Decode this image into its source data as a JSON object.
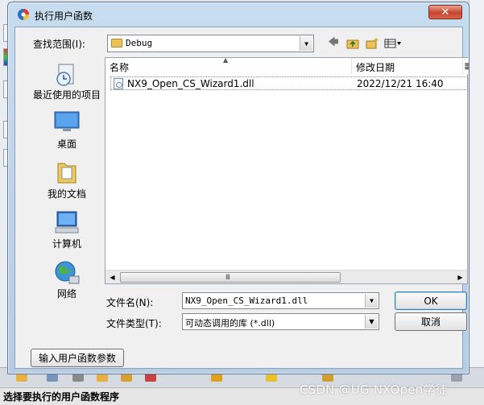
{
  "dialog": {
    "title": "执行用户函数",
    "close_glyph": "✕"
  },
  "look_in": {
    "label": "查找范围(I):",
    "value": "Debug"
  },
  "places": [
    {
      "label": "最近使用的项目",
      "icon": "recent-items-icon"
    },
    {
      "label": "桌面",
      "icon": "desktop-icon"
    },
    {
      "label": "我的文档",
      "icon": "my-documents-icon"
    },
    {
      "label": "计算机",
      "icon": "computer-icon"
    },
    {
      "label": "网络",
      "icon": "network-icon"
    }
  ],
  "file_list": {
    "columns": [
      "名称",
      "修改日期",
      "≣"
    ],
    "rows": [
      {
        "name": "NX9_Open_CS_Wizard1.dll",
        "modified": "2022/12/21 16:40"
      }
    ],
    "scroll_grip": "III"
  },
  "file_name": {
    "label": "文件名(N):",
    "value": "NX9_Open_CS_Wizard1.dll"
  },
  "file_type": {
    "label": "文件类型(T):",
    "value": "可动态调用的库 (*.dll)"
  },
  "buttons": {
    "ok": "OK",
    "cancel": "取消",
    "params": "输入用户函数参数"
  },
  "status_bar": {
    "text": "选择要执行的用户函数程序"
  },
  "watermark": "CSDN @UG NXOpen学徒",
  "colors": {
    "title_bar": "#c7dcef",
    "close_button": "#c7452c",
    "folder": "#e9c35a"
  }
}
